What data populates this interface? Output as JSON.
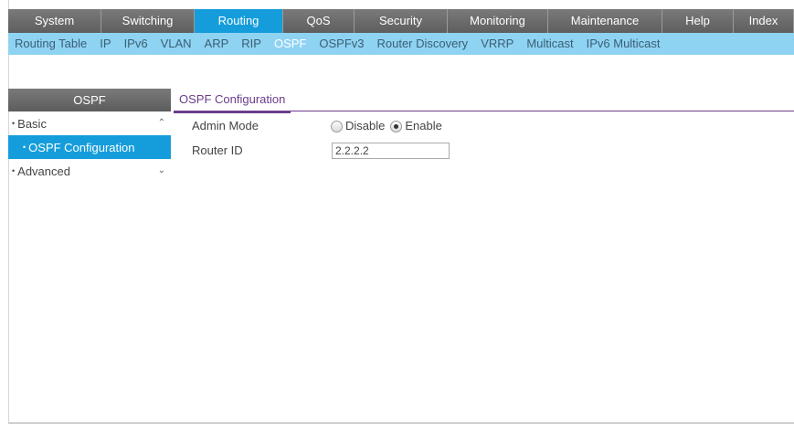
{
  "top_nav": [
    {
      "label": "System",
      "width": 102,
      "active": false
    },
    {
      "label": "Switching",
      "width": 102,
      "active": false
    },
    {
      "label": "Routing",
      "width": 97,
      "active": true
    },
    {
      "label": "QoS",
      "width": 78,
      "active": false
    },
    {
      "label": "Security",
      "width": 102,
      "active": false
    },
    {
      "label": "Monitoring",
      "width": 110,
      "active": false
    },
    {
      "label": "Maintenance",
      "width": 125,
      "active": false
    },
    {
      "label": "Help",
      "width": 78,
      "active": false
    },
    {
      "label": "Index",
      "width": 66,
      "active": false
    }
  ],
  "sub_nav": [
    {
      "label": "Routing Table",
      "active": false
    },
    {
      "label": "IP",
      "active": false
    },
    {
      "label": "IPv6",
      "active": false
    },
    {
      "label": "VLAN",
      "active": false
    },
    {
      "label": "ARP",
      "active": false
    },
    {
      "label": "RIP",
      "active": false
    },
    {
      "label": "OSPF",
      "active": true
    },
    {
      "label": "OSPFv3",
      "active": false
    },
    {
      "label": "Router Discovery",
      "active": false
    },
    {
      "label": "VRRP",
      "active": false
    },
    {
      "label": "Multicast",
      "active": false
    },
    {
      "label": "IPv6 Multicast",
      "active": false
    }
  ],
  "sidebar": {
    "title": "OSPF",
    "items": [
      {
        "label": "Basic",
        "level": 0,
        "selected": false,
        "chevron": "^"
      },
      {
        "label": "OSPF Configuration",
        "level": 1,
        "selected": true,
        "chevron": ""
      },
      {
        "label": "Advanced",
        "level": 0,
        "selected": false,
        "chevron": "v"
      }
    ]
  },
  "main": {
    "tab_label": "OSPF Configuration",
    "admin_mode_label": "Admin Mode",
    "disable_label": "Disable",
    "enable_label": "Enable",
    "admin_mode_value": "Enable",
    "router_id_label": "Router ID",
    "router_id_value": "2.2.2.2"
  },
  "colors": {
    "active_blue": "#159ddb",
    "subnav_bg": "#8fd3f2",
    "tab_purple": "#6b3c8c"
  }
}
